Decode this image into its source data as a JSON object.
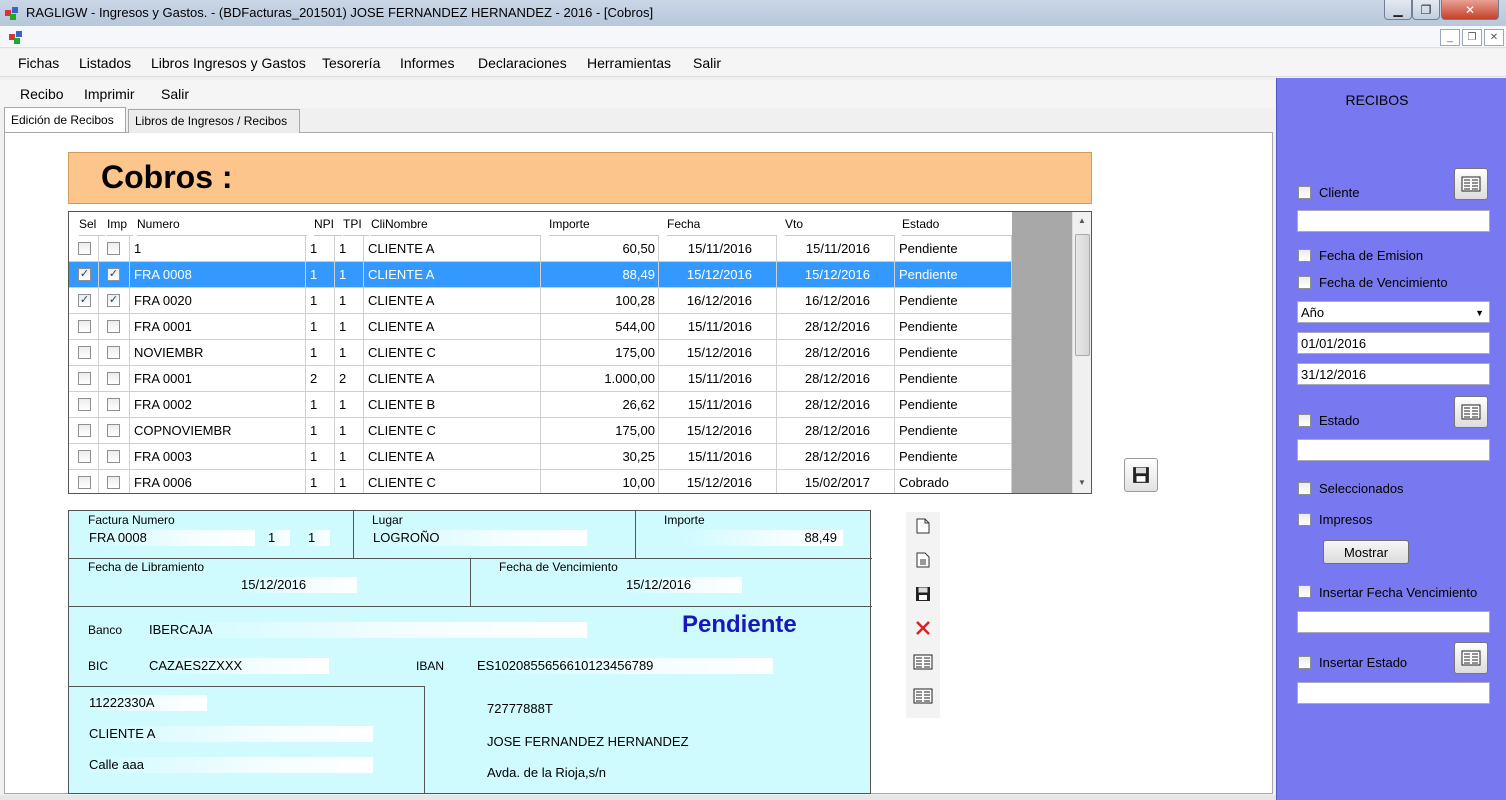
{
  "window": {
    "title": "RAGLIGW - Ingresos y Gastos. - (BDFacturas_201501)   JOSE FERNANDEZ HERNANDEZ - 2016 - [Cobros]"
  },
  "menu": [
    "Fichas",
    "Listados",
    "Libros Ingresos y Gastos",
    "Tesorería",
    "Informes",
    "Declaraciones",
    "Herramientas",
    "Salir"
  ],
  "submenu": [
    "Recibo",
    "Imprimir",
    "Salir"
  ],
  "tabs": [
    "Edición de Recibos",
    "Libros de Ingresos / Recibos"
  ],
  "header": {
    "title": "Cobros :"
  },
  "grid": {
    "columns": [
      "Sel",
      "Imp",
      "Numero",
      "NPI",
      "TPI",
      "CliNombre",
      "Importe",
      "Fecha",
      "Vto",
      "Estado"
    ],
    "rows": [
      {
        "sel": false,
        "imp": false,
        "numero": "1",
        "npi": "1",
        "tpi": "1",
        "cliente": "CLIENTE A",
        "importe": "60,50",
        "fecha": "15/11/2016",
        "vto": "15/11/2016",
        "estado": "Pendiente"
      },
      {
        "sel": true,
        "imp": true,
        "numero": "FRA 0008",
        "npi": "1",
        "tpi": "1",
        "cliente": "CLIENTE A",
        "importe": "88,49",
        "fecha": "15/12/2016",
        "vto": "15/12/2016",
        "estado": "Pendiente",
        "selected": true
      },
      {
        "sel": true,
        "imp": true,
        "numero": "FRA 0020",
        "npi": "1",
        "tpi": "1",
        "cliente": "CLIENTE A",
        "importe": "100,28",
        "fecha": "16/12/2016",
        "vto": "16/12/2016",
        "estado": "Pendiente"
      },
      {
        "sel": false,
        "imp": false,
        "numero": "FRA 0001",
        "npi": "1",
        "tpi": "1",
        "cliente": "CLIENTE A",
        "importe": "544,00",
        "fecha": "15/11/2016",
        "vto": "28/12/2016",
        "estado": "Pendiente"
      },
      {
        "sel": false,
        "imp": false,
        "numero": "NOVIEMBR",
        "npi": "1",
        "tpi": "1",
        "cliente": "CLIENTE C",
        "importe": "175,00",
        "fecha": "15/12/2016",
        "vto": "28/12/2016",
        "estado": "Pendiente"
      },
      {
        "sel": false,
        "imp": false,
        "numero": "FRA 0001",
        "npi": "2",
        "tpi": "2",
        "cliente": "CLIENTE A",
        "importe": "1.000,00",
        "fecha": "15/11/2016",
        "vto": "28/12/2016",
        "estado": "Pendiente"
      },
      {
        "sel": false,
        "imp": false,
        "numero": "FRA 0002",
        "npi": "1",
        "tpi": "1",
        "cliente": "CLIENTE B",
        "importe": "26,62",
        "fecha": "15/11/2016",
        "vto": "28/12/2016",
        "estado": "Pendiente"
      },
      {
        "sel": false,
        "imp": false,
        "numero": "COPNOVIEMBR",
        "npi": "1",
        "tpi": "1",
        "cliente": "CLIENTE C",
        "importe": "175,00",
        "fecha": "15/12/2016",
        "vto": "28/12/2016",
        "estado": "Pendiente"
      },
      {
        "sel": false,
        "imp": false,
        "numero": "FRA 0003",
        "npi": "1",
        "tpi": "1",
        "cliente": "CLIENTE A",
        "importe": "30,25",
        "fecha": "15/11/2016",
        "vto": "28/12/2016",
        "estado": "Pendiente"
      },
      {
        "sel": false,
        "imp": false,
        "numero": "FRA 0006",
        "npi": "1",
        "tpi": "1",
        "cliente": "CLIENTE C",
        "importe": "10,00",
        "fecha": "15/12/2016",
        "vto": "15/02/2017",
        "estado": "Cobrado"
      }
    ]
  },
  "detail": {
    "factura_label": "Factura Numero",
    "factura": "FRA 0008",
    "npi": "1",
    "tpi": "1",
    "lugar_label": "Lugar",
    "lugar": "LOGROÑO",
    "importe_label": "Importe",
    "importe": "88,49",
    "libramiento_label": "Fecha de Libramiento",
    "libramiento": "15/12/2016",
    "vencimiento_label": "Fecha de Vencimiento",
    "vencimiento": "15/12/2016",
    "banco_label": "Banco",
    "banco": "IBERCAJA",
    "estado": "Pendiente",
    "bic_label": "BIC",
    "bic": "CAZAES2ZXXX",
    "iban_label": "IBAN",
    "iban": "ES1020855656610123456789",
    "cliente_nif": "11222330A",
    "cliente_nombre": "CLIENTE A",
    "cliente_dir": "Calle aaa",
    "emisor_nif": "72777888T",
    "emisor_nombre": "JOSE FERNANDEZ HERNANDEZ",
    "emisor_dir": "Avda. de la Rioja,s/n"
  },
  "side": {
    "title": "RECIBOS",
    "cliente_label": "Cliente",
    "fecha_emision_label": "Fecha de Emision",
    "fecha_vencimiento_label": "Fecha de Vencimiento",
    "periodo": "Año",
    "desde": "01/01/2016",
    "hasta": "31/12/2016",
    "estado_label": "Estado",
    "seleccionados_label": "Seleccionados",
    "impresos_label": "Impresos",
    "mostrar_label": "Mostrar",
    "insertar_fecha_label": "Insertar Fecha Vencimiento",
    "insertar_estado_label": "Insertar Estado"
  },
  "colors": {
    "header_bg": "#fcc58c",
    "form_bg": "#cffbff",
    "side_bg": "#7878f0",
    "selection": "#3399ff",
    "estado_text": "#1818c0"
  },
  "icons": [
    "app-icon",
    "minimize-icon",
    "maximize-icon",
    "close-icon",
    "save-icon",
    "new-document-icon",
    "edit-document-icon",
    "delete-icon",
    "list-icon"
  ]
}
